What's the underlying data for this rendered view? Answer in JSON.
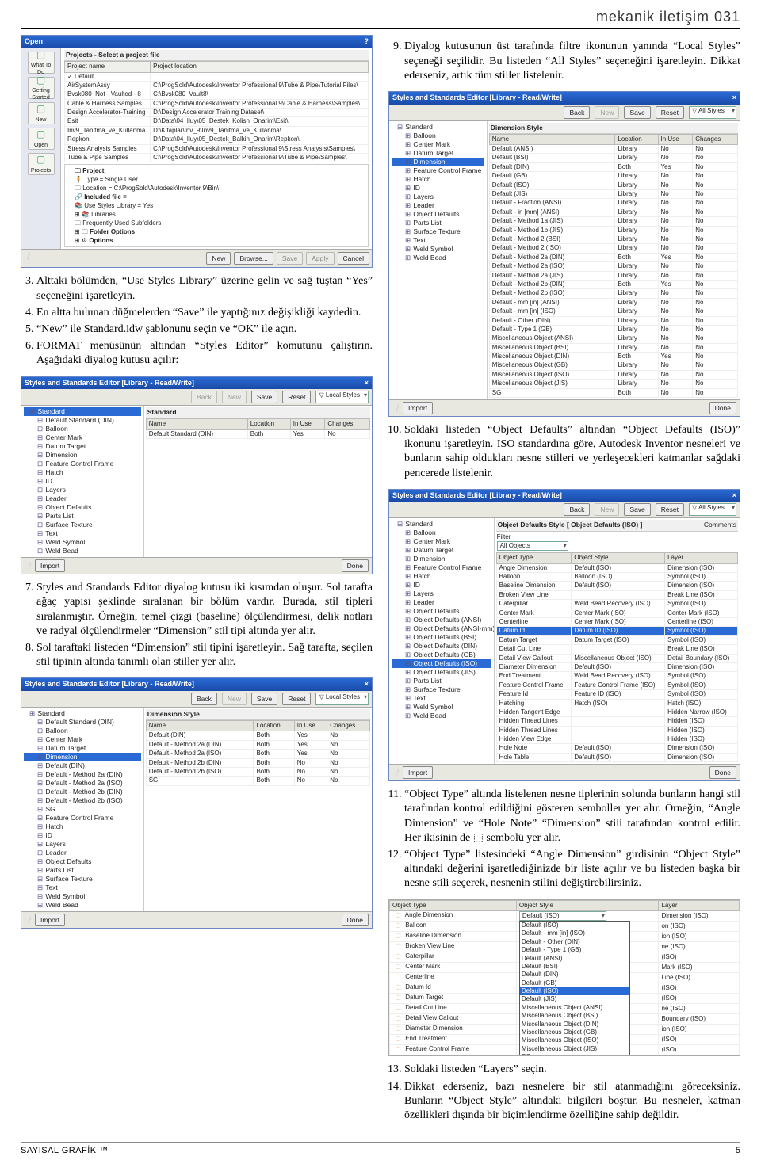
{
  "header": "mekanik iletişim 031",
  "footer": {
    "left": "SAYISAL GRAFİK ™",
    "right": "5"
  },
  "colL": {
    "openDlg": {
      "title": "Open",
      "sidebar": [
        "What To Do",
        "Getting Started",
        "New",
        "Open",
        "Projects"
      ],
      "panelHeading": "Projects - Select a project file",
      "colProjectName": "Project name",
      "colProjectLocation": "Project location",
      "rows": [
        [
          "Default",
          ""
        ],
        [
          "AirSystemAssy",
          "C:\\ProgSold\\Autodesk\\Inventor Professional 9\\Tube & Pipe\\Tutorial Files\\"
        ],
        [
          "Bvsk080_Not - Vaulted - 8",
          "C:\\Bvsk080_Vault8\\"
        ],
        [
          "Cable & Harness Samples",
          "C:\\ProgSold\\Autodesk\\Inventor Professional 9\\Cable & Harness\\Samples\\"
        ],
        [
          "Design Accelerator-Training",
          "D:\\Design Accelerator Training Dataset\\"
        ],
        [
          "Esit",
          "D:\\Data\\04_Iluy\\05_Destek_Kolisn_Onarim\\Esit\\"
        ],
        [
          "Inv9_Tanitma_ve_Kullanma",
          "D:\\Kitaplar\\Inv_9\\Inv9_Tanitma_ve_Kullanma\\"
        ],
        [
          "Repkon",
          "D:\\Data\\04_Iluy\\05_Destek_Balkin_Onarim\\Repkon\\"
        ],
        [
          "Stress Analysis Samples",
          "C:\\ProgSold\\Autodesk\\Inventor Professional 9\\Stress Analysis\\Samples\\"
        ],
        [
          "Tube & Pipe Samples",
          "C:\\ProgSold\\Autodesk\\Inventor Professional 9\\Tube & Pipe\\Samples\\"
        ]
      ],
      "projTree": [
        "Project",
        "Type = Single User",
        "Location = C:\\ProgSold\\Autodesk\\Inventor 9\\Bin\\",
        "Included file =",
        "Use Styles Library = Yes",
        "Libraries",
        "Frequently Used Subfolders",
        "Folder Options",
        "Options"
      ],
      "btnNew": "New",
      "btnBrowse": "Browse...",
      "btnSave": "Save",
      "btnApply": "Apply",
      "btnCancel": "Cancel"
    },
    "firstList": {
      "start": 3,
      "items": [
        "Alttaki bölümden, “Use Styles Library” üzerine gelin ve sağ tuştan “Yes” seçeneğini işaretleyin.",
        "En altta bulunan düğmelerden “Save” ile yaptığınız değişikliği kaydedin.",
        "“New” ile Standard.idw şablonunu seçin ve “OK” ile açın.",
        "FORMAT menüsünün altından “Styles Editor” komutunu çalıştırın. Aşağıdaki diyalog kutusu açılır:"
      ]
    },
    "stylesEditor1": {
      "title": "Styles and Standards Editor [Library - Read/Write]",
      "btnBack": "Back",
      "btnNew": "New",
      "btnSave": "Save",
      "btnReset": "Reset",
      "ddStyles": "Local Styles",
      "tree": [
        "Standard",
        "Default Standard (DIN)",
        "Balloon",
        "Center Mark",
        "Datum Target",
        "Dimension",
        "Feature Control Frame",
        "Hatch",
        "ID",
        "Layers",
        "Leader",
        "Object Defaults",
        "Parts List",
        "Surface Texture",
        "Text",
        "Weld Symbol",
        "Weld Bead"
      ],
      "rightHeading": "Standard",
      "th": [
        "Name",
        "Location",
        "In Use",
        "Changes"
      ],
      "row": [
        "Default Standard (DIN)",
        "Both",
        "Yes",
        "No"
      ],
      "btnImport": "Import",
      "btnDone": "Done"
    },
    "secondList": {
      "start": 7,
      "items": [
        "Styles and Standards Editor diyalog kutusu iki kısımdan oluşur. Sol tarafta ağaç yapısı şeklinde sıralanan bir bölüm vardır. Burada, stil tipleri sıralanmıştır. Örneğin, temel çizgi (baseline) ölçülendirmesi, delik notları ve radyal ölçülendirmeler “Dimension” stil tipi altında yer alır.",
        "Sol taraftaki listeden “Dimension” stil tipini işaretleyin. Sağ tarafta, seçilen stil tipinin altında tanımlı olan stiller yer alır."
      ]
    },
    "stylesEditor2": {
      "title": "Styles and Standards Editor [Library - Read/Write]",
      "btnBack": "Back",
      "btnNew": "New",
      "btnSave": "Save",
      "btnReset": "Reset",
      "ddStyles": "Local Styles",
      "tree": [
        "Standard",
        "Default Standard (DIN)",
        "Balloon",
        "Center Mark",
        "Datum Target",
        "Dimension",
        "Default (DIN)",
        "Default - Method 2a (DIN)",
        "Default - Method 2a (ISO)",
        "Default - Method 2b (DIN)",
        "Default - Method 2b (ISO)",
        "SG",
        "Feature Control Frame",
        "Hatch",
        "ID",
        "Layers",
        "Leader",
        "Object Defaults",
        "Parts List",
        "Surface Texture",
        "Text",
        "Weld Symbol",
        "Weld Bead"
      ],
      "rightHeading": "Dimension Style",
      "th": [
        "Name",
        "Location",
        "In Use",
        "Changes"
      ],
      "rows": [
        [
          "Default (DIN)",
          "Both",
          "Yes",
          "No"
        ],
        [
          "Default - Method 2a (DIN)",
          "Both",
          "Yes",
          "No"
        ],
        [
          "Default - Method 2a (ISO)",
          "Both",
          "Yes",
          "No"
        ],
        [
          "Default - Method 2b (DIN)",
          "Both",
          "No",
          "No"
        ],
        [
          "Default - Method 2b (ISO)",
          "Both",
          "No",
          "No"
        ],
        [
          "SG",
          "Both",
          "No",
          "No"
        ]
      ],
      "btnImport": "Import",
      "btnDone": "Done"
    }
  },
  "colR": {
    "firstList": {
      "start": 9,
      "items": [
        "Diyalog kutusunun üst tarafında filtre ikonunun yanında “Local Styles” seçeneği seçilidir. Bu listeden “All Styles” seçeneğini işaretleyin. Dikkat ederseniz, artık tüm stiller listelenir."
      ]
    },
    "stylesEditor3": {
      "title": "Styles and Standards Editor [Library - Read/Write]",
      "btnBack": "Back",
      "btnNew": "New",
      "btnSave": "Save",
      "btnReset": "Reset",
      "ddStyles": "All Styles",
      "tree": [
        "Standard",
        "Balloon",
        "Center Mark",
        "Datum Target",
        "Dimension",
        "Feature Control Frame",
        "Hatch",
        "ID",
        "Layers",
        "Leader",
        "Object Defaults",
        "Parts List",
        "Surface Texture",
        "Text",
        "Weld Symbol",
        "Weld Bead"
      ],
      "rightHeading": "Dimension Style",
      "th": [
        "Name",
        "Location",
        "In Use",
        "Changes"
      ],
      "rows": [
        [
          "Default (ANSI)",
          "Library",
          "No",
          "No"
        ],
        [
          "Default (BSI)",
          "Library",
          "No",
          "No"
        ],
        [
          "Default (DIN)",
          "Both",
          "Yes",
          "No"
        ],
        [
          "Default (GB)",
          "Library",
          "No",
          "No"
        ],
        [
          "Default (ISO)",
          "Library",
          "No",
          "No"
        ],
        [
          "Default (JIS)",
          "Library",
          "No",
          "No"
        ],
        [
          "Default - Fraction (ANSI)",
          "Library",
          "No",
          "No"
        ],
        [
          "Default - in [mm] (ANSI)",
          "Library",
          "No",
          "No"
        ],
        [
          "Default - Method 1a (JIS)",
          "Library",
          "No",
          "No"
        ],
        [
          "Default - Method 1b (JIS)",
          "Library",
          "No",
          "No"
        ],
        [
          "Default - Method 2 (BSI)",
          "Library",
          "No",
          "No"
        ],
        [
          "Default - Method 2 (ISO)",
          "Library",
          "No",
          "No"
        ],
        [
          "Default - Method 2a (DIN)",
          "Both",
          "Yes",
          "No"
        ],
        [
          "Default - Method 2a (ISO)",
          "Library",
          "No",
          "No"
        ],
        [
          "Default - Method 2a (JIS)",
          "Library",
          "No",
          "No"
        ],
        [
          "Default - Method 2b (DIN)",
          "Both",
          "Yes",
          "No"
        ],
        [
          "Default - Method 2b (ISO)",
          "Library",
          "No",
          "No"
        ],
        [
          "Default - mm [in] (ANSI)",
          "Library",
          "No",
          "No"
        ],
        [
          "Default - mm [in] (ISO)",
          "Library",
          "No",
          "No"
        ],
        [
          "Default - Other (DIN)",
          "Library",
          "No",
          "No"
        ],
        [
          "Default - Type 1 (GB)",
          "Library",
          "No",
          "No"
        ],
        [
          "Miscellaneous Object (ANSI)",
          "Library",
          "No",
          "No"
        ],
        [
          "Miscellaneous Object (BSI)",
          "Library",
          "No",
          "No"
        ],
        [
          "Miscellaneous Object (DIN)",
          "Both",
          "Yes",
          "No"
        ],
        [
          "Miscellaneous Object (GB)",
          "Library",
          "No",
          "No"
        ],
        [
          "Miscellaneous Object (ISO)",
          "Library",
          "No",
          "No"
        ],
        [
          "Miscellaneous Object (JIS)",
          "Library",
          "No",
          "No"
        ],
        [
          "SG",
          "Both",
          "No",
          "No"
        ]
      ],
      "btnImport": "Import",
      "btnDone": "Done"
    },
    "secondList": {
      "start": 10,
      "items": [
        "Soldaki listeden “Object Defaults” altından “Object Defaults (ISO)” ikonunu işaretleyin. ISO standardına göre, Autodesk Inventor nesneleri ve bunların sahip oldukları nesne stilleri ve yerleşecekleri katmanlar sağdaki pencerede listelenir."
      ]
    },
    "stylesEditor4": {
      "title": "Styles and Standards Editor [Library - Read/Write]",
      "btnBack": "Back",
      "btnNew": "New",
      "btnSave": "Save",
      "btnReset": "Reset",
      "ddStyles": "All Styles",
      "tree": [
        "Standard",
        "Balloon",
        "Center Mark",
        "Datum Target",
        "Dimension",
        "Feature Control Frame",
        "Hatch",
        "ID",
        "Layers",
        "Leader",
        "Object Defaults",
        "Object Defaults (ANSI)",
        "Object Defaults (ANSI-mm)",
        "Object Defaults (BSI)",
        "Object Defaults (DIN)",
        "Object Defaults (GB)",
        "Object Defaults (ISO)",
        "Object Defaults (JIS)",
        "Parts List",
        "Surface Texture",
        "Text",
        "Weld Symbol",
        "Weld Bead"
      ],
      "rightHeading": "Object Defaults Style [ Object Defaults (ISO) ]",
      "commentsLabel": "Comments",
      "filterLabel": "Filter",
      "filterValue": "All Objects",
      "th": [
        "Object Type",
        "Object Style",
        "Layer"
      ],
      "rows": [
        [
          "Angle Dimension",
          "Default (ISO)",
          "Dimension (ISO)"
        ],
        [
          "Balloon",
          "Balloon (ISO)",
          "Symbol (ISO)"
        ],
        [
          "Baseline Dimension",
          "Default (ISO)",
          "Dimension (ISO)"
        ],
        [
          "Broken View Line",
          "",
          "Break Line (ISO)"
        ],
        [
          "Caterpillar",
          "Weld Bead Recovery (ISO)",
          "Symbol (ISO)"
        ],
        [
          "Center Mark",
          "Center Mark (ISO)",
          "Center Mark (ISO)"
        ],
        [
          "Centerline",
          "Center Mark (ISO)",
          "Centerline (ISO)"
        ],
        [
          "Datum Id",
          "Datum ID (ISO)",
          "Symbol (ISO)"
        ],
        [
          "Datum Target",
          "Datum Target (ISO)",
          "Symbol (ISO)"
        ],
        [
          "Detail Cut Line",
          "",
          "Break Line (ISO)"
        ],
        [
          "Detail View Callout",
          "Miscellaneous Object (ISO)",
          "Detail Boundary (ISO)"
        ],
        [
          "Diameter Dimension",
          "Default (ISO)",
          "Dimension (ISO)"
        ],
        [
          "End Treatment",
          "Weld Bead Recovery (ISO)",
          "Symbol (ISO)"
        ],
        [
          "Feature Control Frame",
          "Feature Control Frame (ISO)",
          "Symbol (ISO)"
        ],
        [
          "Feature Id",
          "Feature ID (ISO)",
          "Symbol (ISO)"
        ],
        [
          "Hatching",
          "Hatch (ISO)",
          "Hatch (ISO)"
        ],
        [
          "Hidden Tangent Edge",
          "",
          "Hidden Narrow (ISO)"
        ],
        [
          "Hidden Thread Lines",
          "",
          "Hidden (ISO)"
        ],
        [
          "Hidden Thread Lines",
          "",
          "Hidden (ISO)"
        ],
        [
          "Hidden View Edge",
          "",
          "Hidden (ISO)"
        ],
        [
          "Hole Note",
          "Default (ISO)",
          "Dimension (ISO)"
        ],
        [
          "Hole Table",
          "Default (ISO)",
          "Dimension (ISO)"
        ]
      ],
      "btnImport": "Import",
      "btnDone": "Done"
    },
    "thirdList": {
      "start": 11,
      "items": [
        "“Object Type” altında listelenen nesne tiplerinin solunda bunların hangi stil tarafından kontrol edildiğini gösteren semboller yer alır. Örneğin, “Angle Dimension” ve “Hole Note” “Dimension” stili tarafından kontrol edilir. Her ikisinin de ⬚ sembolü yer alır.",
        "“Object Type” listesindeki “Angle Dimension” girdisinin “Object Style” altındaki değerini işaretlediğinizde bir liste açılır ve bu listeden başka bir nesne stili seçerek, nesnenin stilini değiştirebilirsiniz."
      ]
    },
    "cropped": {
      "th": [
        "Object Type",
        "Object Style",
        "Layer"
      ],
      "selValue": "Default (ISO)",
      "ddOptions": [
        "Default (ISO)",
        "Default - mm [in] (ISO)",
        "Default - Other (DIN)",
        "Default - Type 1 (GB)",
        "Default (ANSI)",
        "Default (BSI)",
        "Default (DIN)",
        "Default (GB)",
        "Default (ISO)",
        "Default (JIS)",
        "Miscellaneous Object (ANSI)",
        "Miscellaneous Object (BSI)",
        "Miscellaneous Object (DIN)",
        "Miscellaneous Object (GB)",
        "Miscellaneous Object (ISO)",
        "Miscellaneous Object (JIS)",
        "SG"
      ],
      "rows": [
        [
          "Angle Dimension",
          "Default (ISO)",
          "Dimension (ISO)"
        ],
        [
          "Balloon",
          "",
          "on (ISO)"
        ],
        [
          "Baseline Dimension",
          "",
          "ion (ISO)"
        ],
        [
          "Broken View Line",
          "",
          "ne (ISO)"
        ],
        [
          "Caterpillar",
          "",
          "(ISO)"
        ],
        [
          "Center Mark",
          "",
          "Mark (ISO)"
        ],
        [
          "Centerline",
          "",
          "Line (ISO)"
        ],
        [
          "Datum Id",
          "",
          "(ISO)"
        ],
        [
          "Datum Target",
          "",
          "(ISO)"
        ],
        [
          "Detail Cut Line",
          "",
          "ne (ISO)"
        ],
        [
          "Detail View Callout",
          "",
          "Boundary (ISO)"
        ],
        [
          "Diameter Dimension",
          "",
          "ion (ISO)"
        ],
        [
          "End Treatment",
          "",
          "(ISO)"
        ],
        [
          "Feature Control Frame",
          "",
          "(ISO)"
        ]
      ]
    },
    "fourthList": {
      "start": 13,
      "items": [
        "Soldaki listeden “Layers” seçin.",
        "Dikkat ederseniz, bazı nesnelere bir stil atanmadığını göreceksiniz. Bunların “Object Style” altındaki bilgileri boştur. Bu nesneler, katman özellikleri dışında bir biçimlendirme özelliğine sahip değildir."
      ]
    }
  }
}
